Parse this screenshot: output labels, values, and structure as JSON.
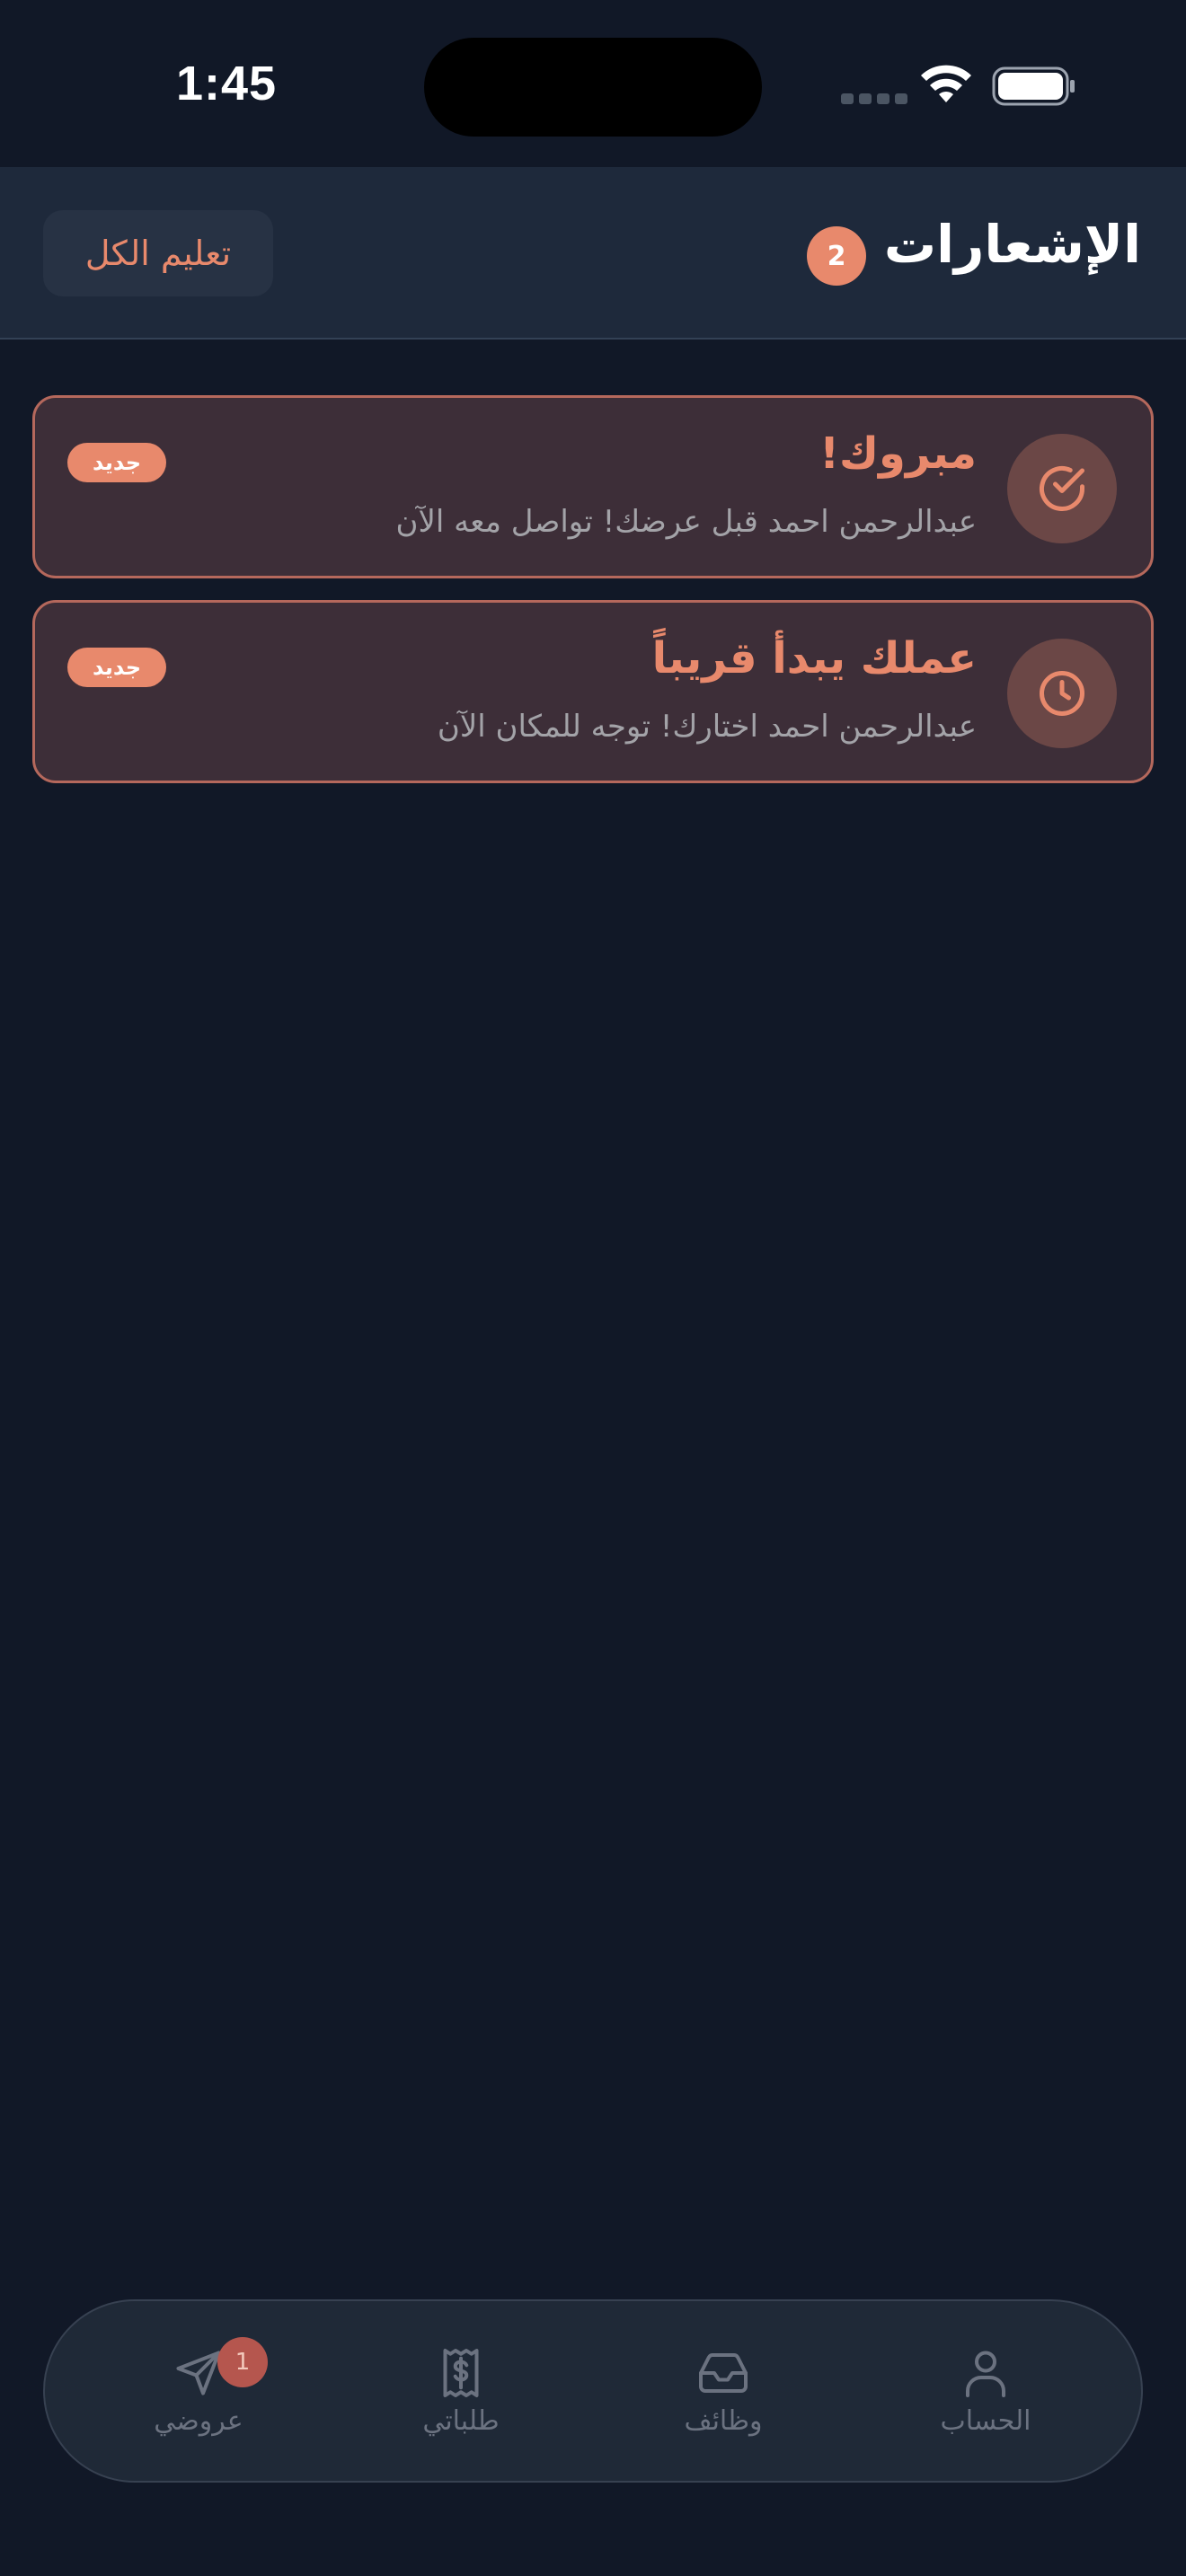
{
  "status_bar": {
    "time": "1:45",
    "icons": [
      "cellular-signal-icon",
      "wifi-icon",
      "battery-icon"
    ]
  },
  "header": {
    "title": "الإشعارات",
    "unread_count": "2",
    "mark_all_label": "تعليم الكل"
  },
  "notifications": [
    {
      "icon": "check-circle-icon",
      "title": "مبروك!",
      "body": "عبدالرحمن  احمد قبل عرضك! تواصل معه الآن",
      "badge": "جديد"
    },
    {
      "icon": "clock-icon",
      "title": "عملك يبدأ قريباً",
      "body": "عبدالرحمن  احمد اختارك! توجه للمكان الآن",
      "badge": "جديد"
    }
  ],
  "bottom_nav": {
    "items": [
      {
        "label": "عروضي",
        "icon": "send-icon",
        "badge": "1"
      },
      {
        "label": "طلباتي",
        "icon": "receipt-icon"
      },
      {
        "label": "وظائف",
        "icon": "inbox-icon"
      },
      {
        "label": "الحساب",
        "icon": "user-icon"
      }
    ]
  },
  "colors": {
    "background": "#111827",
    "header_bg": "#1e293b",
    "accent": "#e8896c",
    "card_bg": "#3d2e38",
    "card_border": "#b5685c",
    "muted_text": "#a3a3a8",
    "nav_icon": "#6b7280"
  }
}
